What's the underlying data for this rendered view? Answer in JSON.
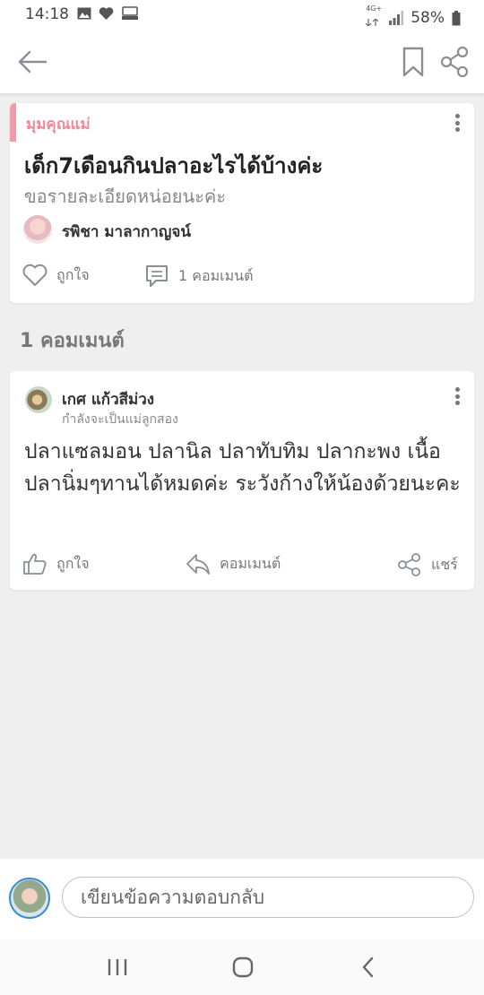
{
  "status_bar": {
    "time": "14:18",
    "network": "4G+",
    "battery": "58%",
    "icons": [
      "image-icon",
      "heart-icon",
      "blast-icon",
      "signal-icon",
      "battery-icon"
    ]
  },
  "app_bar": {
    "icons": [
      "back-arrow-icon",
      "bookmark-icon",
      "share-icon"
    ]
  },
  "post": {
    "category": "มุมคุณแม่",
    "title": "เด็ก7เดือนกินปลาอะไรได้บ้างค่ะ",
    "subtitle": "ขอรายละเอียดหน่อยนะค่ะ",
    "author": "รพิชา มาลากาญจน์",
    "like_label": "ถูกใจ",
    "comment_label": "1 คอมเมนต์"
  },
  "comments_header": "1 คอมเมนต์",
  "comment": {
    "author": "เกศ แก้วสีม่วง",
    "status": "กำลังจะเป็นแม่ลูกสอง",
    "body": "ปลาแซลมอน ปลานิล ปลาทับทิม ปลากะพง เนื้อปลานิ่มๆทานได้หมดค่ะ ระวังก้างให้น้องด้วยนะคะ",
    "like_label": "ถูกใจ",
    "reply_label": "คอมเมนต์",
    "share_label": "แชร์"
  },
  "reply": {
    "placeholder": "เขียนข้อความตอบกลับ"
  },
  "colors": {
    "accent_pink": "#f0899a",
    "icon_gray": "#8a8f96",
    "avatar_ring": "#3a8bd6"
  }
}
